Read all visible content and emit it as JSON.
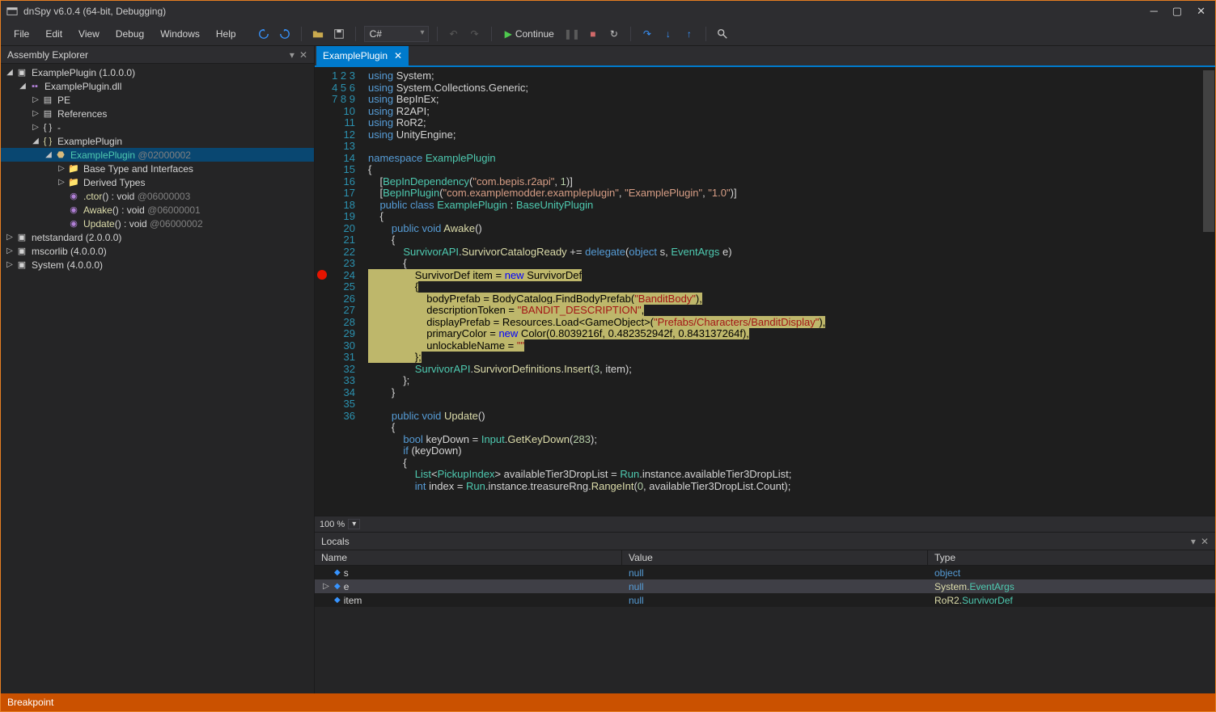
{
  "title": "dnSpy v6.0.4 (64-bit, Debugging)",
  "menu": [
    "File",
    "Edit",
    "View",
    "Debug",
    "Windows",
    "Help"
  ],
  "lang": "C#",
  "continue_label": "Continue",
  "sidebar_title": "Assembly Explorer",
  "tree": {
    "root": {
      "label": "ExamplePlugin (1.0.0.0)"
    },
    "dll": {
      "label": "ExamplePlugin.dll"
    },
    "pe": "PE",
    "refs": "References",
    "dash": "-",
    "ns": "ExamplePlugin",
    "class": {
      "name": "ExamplePlugin",
      "tok": "@02000002"
    },
    "bti": "Base Type and Interfaces",
    "dt": "Derived Types",
    "ctor": {
      "name": ".ctor",
      "sig": "() : void ",
      "tok": "@06000003"
    },
    "awake": {
      "name": "Awake",
      "sig": "() : void ",
      "tok": "@06000001"
    },
    "update": {
      "name": "Update",
      "sig": "() : void ",
      "tok": "@06000002"
    },
    "netstd": "netstandard (2.0.0.0)",
    "mscor": "mscorlib (4.0.0.0)",
    "system": "System (4.0.0.0)"
  },
  "tab": {
    "label": "ExamplePlugin"
  },
  "code_lines": 36,
  "breakpoint_line": 18,
  "zoom": "100 %",
  "locals_title": "Locals",
  "locals_cols": {
    "name": "Name",
    "value": "Value",
    "type": "Type"
  },
  "locals": [
    {
      "name": "s",
      "value": "null",
      "type_ns": "",
      "type_cls": "object",
      "exp": false
    },
    {
      "name": "e",
      "value": "null",
      "type_ns": "System.",
      "type_cls": "EventArgs",
      "exp": true
    },
    {
      "name": "item",
      "value": "null",
      "type_ns": "RoR2.",
      "type_cls": "SurvivorDef",
      "exp": false
    }
  ],
  "status": "Breakpoint",
  "code": {
    "l1": "using System;",
    "l2": "using System.Collections.Generic;",
    "l3": "using BepInEx;",
    "l4": "using R2API;",
    "l5": "using RoR2;",
    "l6": "using UnityEngine;",
    "l8": "namespace ExamplePlugin",
    "l10": "[BepInDependency(\"com.bepis.r2api\", 1)]",
    "l11": "[BepInPlugin(\"com.examplemodder.exampleplugin\", \"ExamplePlugin\", \"1.0\")]",
    "l12": "public class ExamplePlugin : BaseUnityPlugin",
    "l14": "public void Awake()",
    "l16": "SurvivorAPI.SurvivorCatalogReady += delegate(object s, EventArgs e)",
    "l18": "SurvivorDef item = new SurvivorDef",
    "l20": "bodyPrefab = BodyCatalog.FindBodyPrefab(\"BanditBody\"),",
    "l21": "descriptionToken = \"BANDIT_DESCRIPTION\",",
    "l22": "displayPrefab = Resources.Load<GameObject>(\"Prefabs/Characters/BanditDisplay\"),",
    "l23": "primaryColor = new Color(0.8039216f, 0.482352942f, 0.843137264f),",
    "l24": "unlockableName = \"\"",
    "l26": "SurvivorAPI.SurvivorDefinitions.Insert(3, item);",
    "l30": "public void Update()",
    "l32": "bool keyDown = Input.GetKeyDown(283);",
    "l33": "if (keyDown)",
    "l35": "List<PickupIndex> availableTier3DropList = Run.instance.availableTier3DropList;",
    "l36": "int index = Run.instance.treasureRng.RangeInt(0, availableTier3DropList.Count);"
  }
}
